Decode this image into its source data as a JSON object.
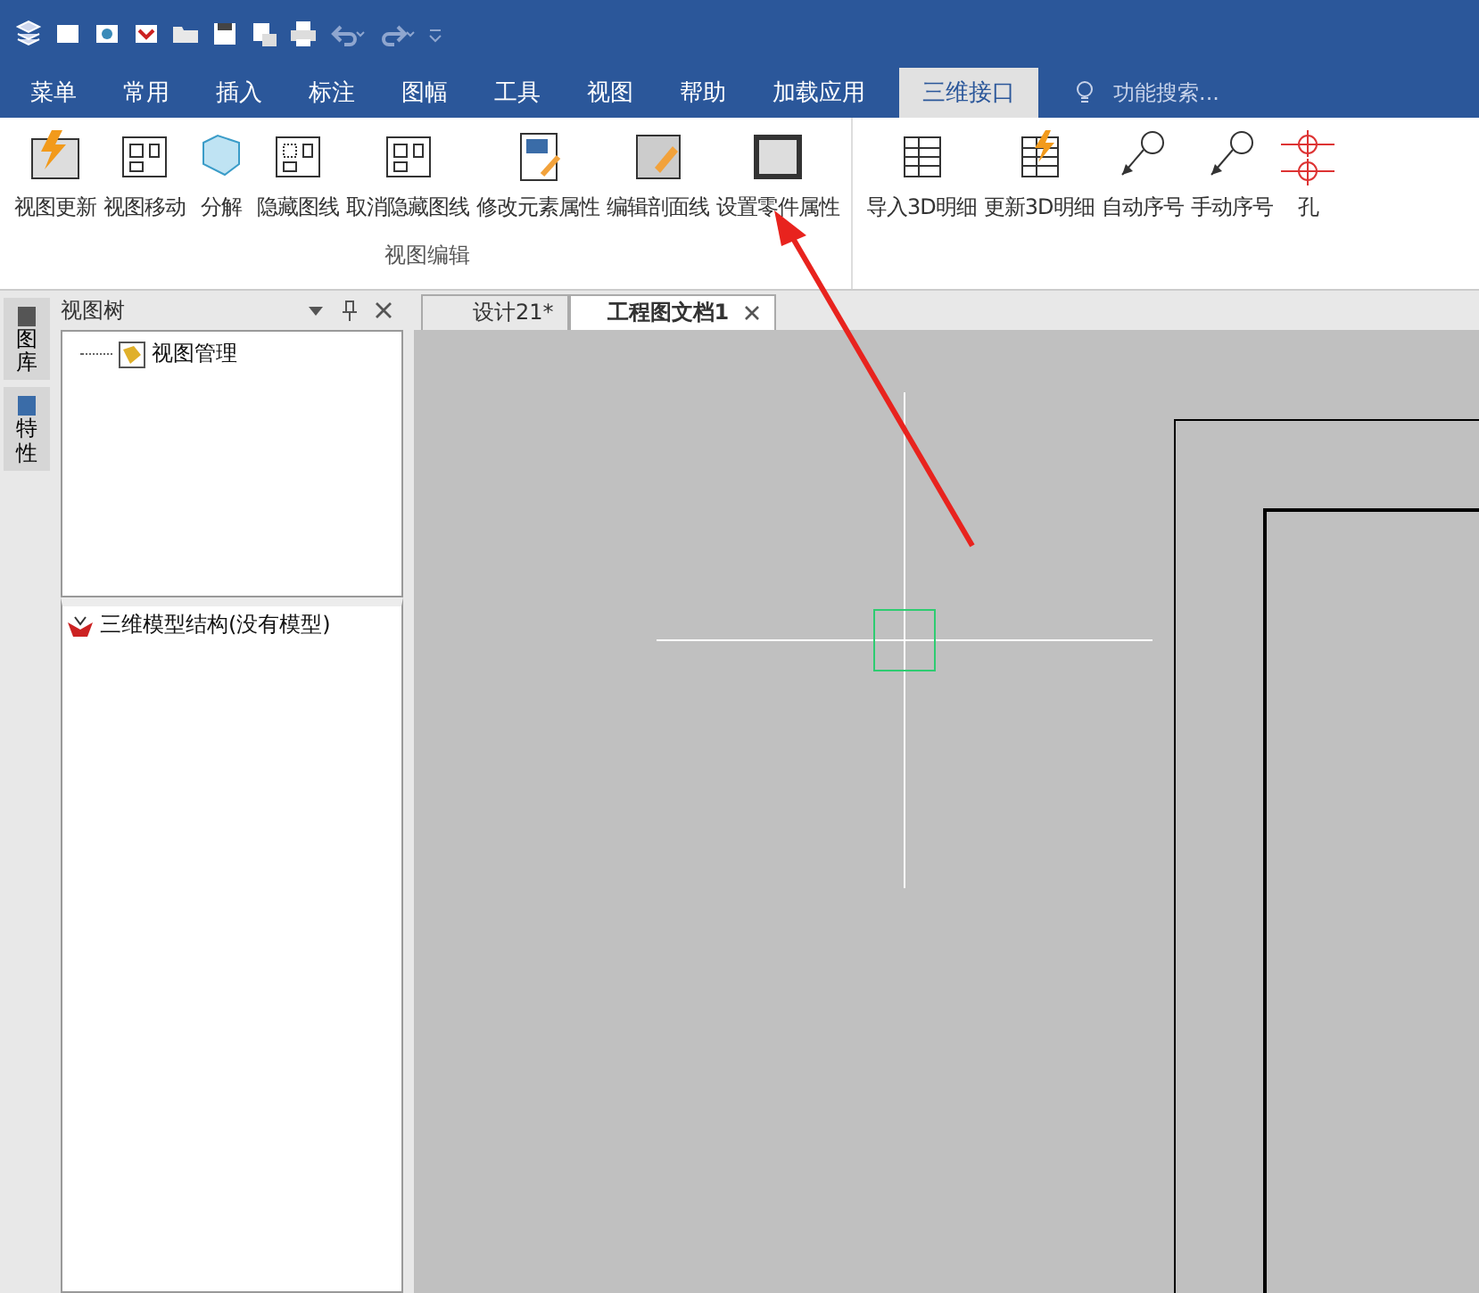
{
  "menu_tabs": [
    {
      "label": "菜单",
      "selected": false
    },
    {
      "label": "常用",
      "selected": false
    },
    {
      "label": "插入",
      "selected": false
    },
    {
      "label": "标注",
      "selected": false
    },
    {
      "label": "图幅",
      "selected": false
    },
    {
      "label": "工具",
      "selected": false
    },
    {
      "label": "视图",
      "selected": false
    },
    {
      "label": "帮助",
      "selected": false
    },
    {
      "label": "加载应用",
      "selected": false
    },
    {
      "label": "三维接口",
      "selected": true
    }
  ],
  "search": {
    "placeholder": "功能搜索..."
  },
  "ribbon_groups": [
    {
      "label": "视图编辑",
      "buttons": [
        "视图更新",
        "视图移动",
        "分解",
        "隐藏图线",
        "取消隐藏图线",
        "修改元素属性",
        "编辑剖面线",
        "设置零件属性"
      ]
    },
    {
      "buttons": [
        "导入3D明细",
        "更新3D明细",
        "自动序号",
        "手动序号",
        "孔"
      ]
    }
  ],
  "side_tabs": [
    "图库",
    "特性"
  ],
  "panel": {
    "title": "视图树",
    "tree": [
      {
        "label": "视图管理"
      }
    ],
    "model_section": "三维模型结构(没有模型)"
  },
  "doc_tabs": [
    {
      "label": "设计21*",
      "selected": false
    },
    {
      "label": "工程图文档1",
      "selected": true
    }
  ]
}
